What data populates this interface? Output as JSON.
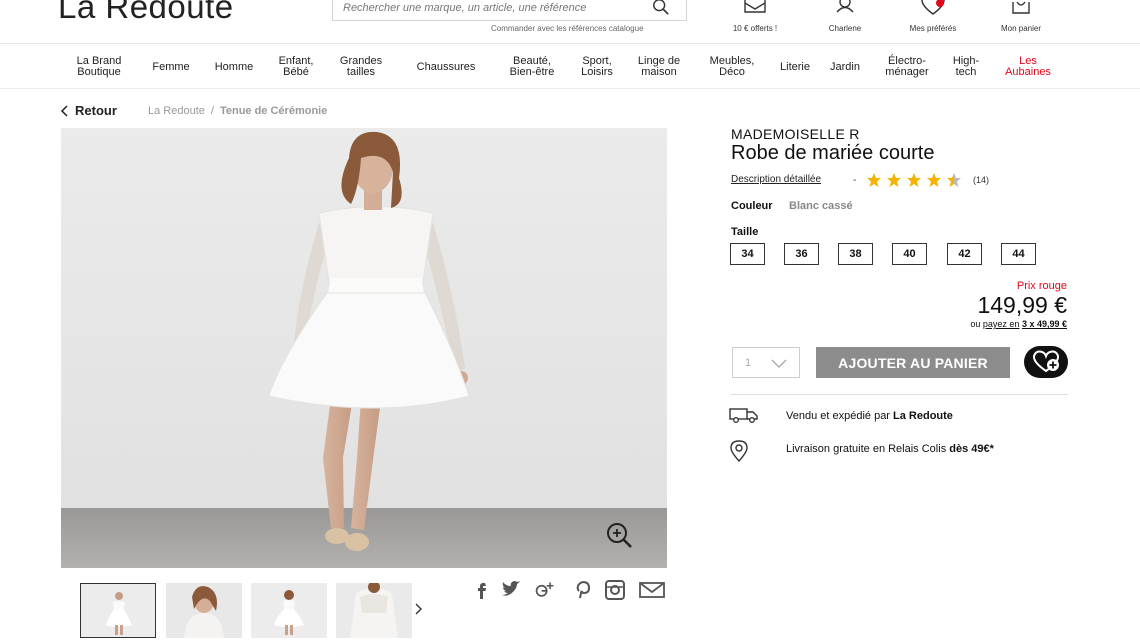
{
  "header": {
    "logo": "La Redoute",
    "search_placeholder": "Rechercher une marque, un article, une référence",
    "catalog_link": "Commander avec les références catalogue",
    "items": [
      {
        "label": "10 € offerts !",
        "icon": "envelope-icon"
      },
      {
        "label": "Charlene",
        "icon": "user-icon"
      },
      {
        "label": "Mes préférés",
        "icon": "heart-icon"
      },
      {
        "label": "Mon panier",
        "icon": "bag-icon"
      }
    ]
  },
  "nav": [
    {
      "label": "La Brand\nBoutique",
      "color": "#222222"
    },
    {
      "label": "Femme",
      "color": "#222222"
    },
    {
      "label": "Homme",
      "color": "#222222"
    },
    {
      "label": "Enfant,\nBébé",
      "color": "#222222"
    },
    {
      "label": "Grandes\ntailles",
      "color": "#222222"
    },
    {
      "label": "Chaussures",
      "color": "#222222"
    },
    {
      "label": "Beauté,\nBien-être",
      "color": "#222222"
    },
    {
      "label": "Sport,\nLoisirs",
      "color": "#222222"
    },
    {
      "label": "Linge de\nmaison",
      "color": "#222222"
    },
    {
      "label": "Meubles,\nDéco",
      "color": "#222222"
    },
    {
      "label": "Literie",
      "color": "#222222"
    },
    {
      "label": "Jardin",
      "color": "#222222"
    },
    {
      "label": "Électro-\nménager",
      "color": "#222222"
    },
    {
      "label": "High-\ntech",
      "color": "#222222"
    },
    {
      "label": "Les\nAubaines",
      "color": "#e2061a"
    }
  ],
  "breadcrumb": {
    "back": "Retour",
    "home": "La Redoute",
    "separator": "/",
    "current": "Tenue de Cérémonie"
  },
  "product": {
    "brand": "MADEMOISELLE R",
    "title": "Robe de mariée courte",
    "description_link": "Description détaillée",
    "dash": "-",
    "rating": 4.5,
    "rating_max": 5,
    "reviews": "(14)",
    "color_label": "Couleur",
    "color_value": "Blanc cassé",
    "size_label": "Taille",
    "sizes": [
      "34",
      "36",
      "38",
      "40",
      "42",
      "44"
    ],
    "price_tag": "Prix rouge",
    "price": "149,99 €",
    "installment": {
      "prefix": "ou",
      "link": "payez en",
      "amount": "3 x 49,99 €"
    },
    "quantity": "1",
    "add_to_cart": "AJOUTER AU PANIER"
  },
  "shipping": [
    {
      "icon": "truck-icon",
      "text": "Vendu et expédié par ",
      "bold": "La Redoute"
    },
    {
      "icon": "location-pin-icon",
      "text": "Livraison gratuite en Relais Colis ",
      "bold": "dès 49€*"
    }
  ],
  "share_icons": [
    "facebook-icon",
    "twitter-icon",
    "google-plus-icon",
    "pinterest-icon",
    "instagram-icon",
    "mail-icon"
  ],
  "thumbnails": [
    "front-view",
    "close-up",
    "back-view",
    "sleeve-detail"
  ],
  "colors": {
    "accent_red": "#e2061a",
    "button_grey": "#8c8c8c",
    "star": "#f5b301"
  }
}
